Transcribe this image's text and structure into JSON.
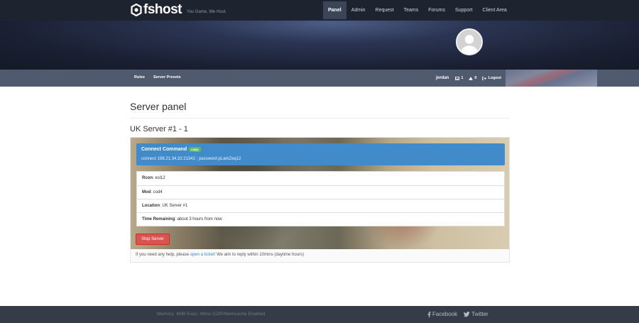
{
  "brand": {
    "name": "fshost",
    "tagline": "You Game, We Host."
  },
  "nav": {
    "items": [
      {
        "label": "Panel",
        "active": true
      },
      {
        "label": "Admin"
      },
      {
        "label": "Request"
      },
      {
        "label": "Teams"
      },
      {
        "label": "Forums"
      },
      {
        "label": "Support"
      },
      {
        "label": "Client Area"
      }
    ]
  },
  "subnav": {
    "left": [
      "Rules",
      "Server Presets"
    ],
    "user": "jordan",
    "messages_count": "1",
    "alerts_count": "0",
    "logout_label": "Logout"
  },
  "page": {
    "title": "Server panel",
    "server_name": "UK Server #1 - 1"
  },
  "connect": {
    "title": "Connect Command",
    "copy_label": "copy",
    "command": "connect 198.21.34.32:21342 ; password pLamZeq12"
  },
  "info": {
    "rcon": {
      "label": "Rcon",
      "value": ": esl12"
    },
    "mod": {
      "label": "Mod",
      "value": ": cod4"
    },
    "location": {
      "label": "Location",
      "value": ": UK Server #1"
    },
    "time": {
      "label": "Time Remaining",
      "value": ": about 3 hours from now"
    }
  },
  "actions": {
    "stop_label": "Stop Server"
  },
  "help": {
    "prefix": "If you need any help, please ",
    "link": "open a ticket!",
    "suffix": " We aim to reply within 10mins (daytime hours)"
  },
  "footer": {
    "stats": "Memory: 4MB   Exec: 49ms   GZIP/Memcache Enabled",
    "facebook": "Facebook",
    "twitter": "Twitter"
  },
  "colors": {
    "nav_bg": "#1d2430",
    "subnav_bg": "#505a6f",
    "connect_bg": "#428bca",
    "copy_badge": "#5cb85c",
    "stop_button": "#d9534f",
    "footer_bg": "#363c47"
  },
  "icons": {
    "logo": "fshost-logo-icon",
    "avatar": "user-avatar-icon",
    "messages": "inbox-icon",
    "alerts": "warning-icon",
    "logout": "logout-icon",
    "facebook": "facebook-icon",
    "twitter": "twitter-icon"
  }
}
